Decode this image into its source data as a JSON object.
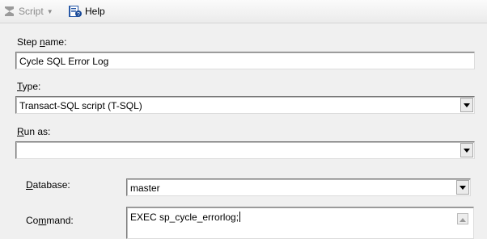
{
  "toolbar": {
    "script_label": "Script",
    "help_label": "Help",
    "script_icon": "script-icon",
    "help_icon": "help-book-icon"
  },
  "form": {
    "step_name": {
      "label_prefix": "Step ",
      "label_key": "n",
      "label_suffix": "ame:",
      "value": "Cycle SQL Error Log"
    },
    "type": {
      "label_key": "T",
      "label_suffix": "ype:",
      "value": "Transact-SQL script (T-SQL)"
    },
    "run_as": {
      "label_key": "R",
      "label_suffix": "un as:",
      "value": ""
    },
    "database": {
      "label_key": "D",
      "label_suffix": "atabase:",
      "value": "master"
    },
    "command": {
      "label_prefix": "Co",
      "label_key": "m",
      "label_suffix": "mand:",
      "value": "EXEC sp_cycle_errorlog;"
    }
  }
}
